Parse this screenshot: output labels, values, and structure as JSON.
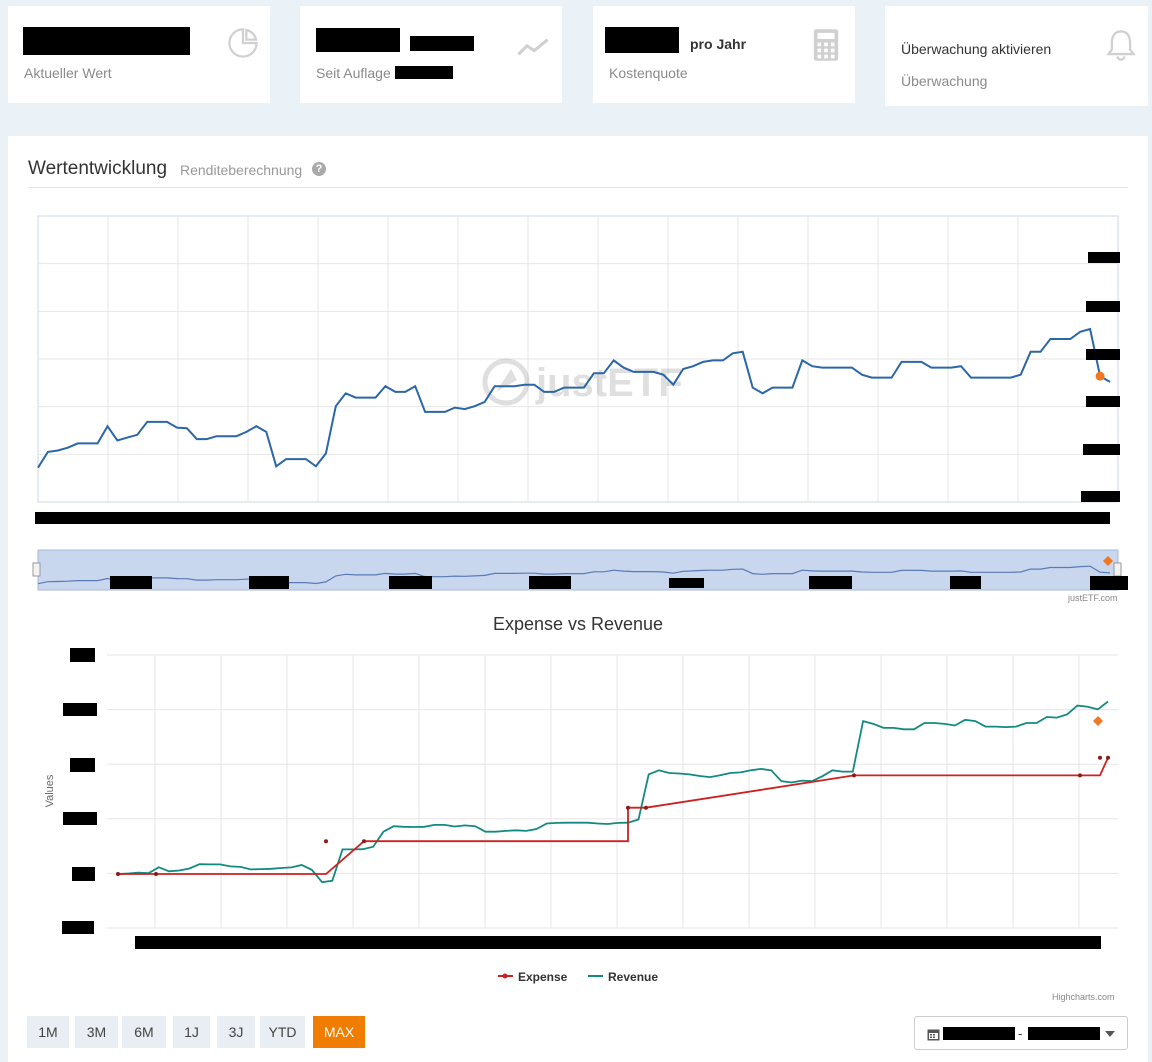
{
  "kpis": [
    {
      "sub": "Aktueller Wert",
      "icon": "pie-chart-icon"
    },
    {
      "sub": "Seit Auflage",
      "icon": "trend-line-icon"
    },
    {
      "suffix": "pro Jahr",
      "sub": "Kostenquote",
      "icon": "calculator-icon"
    },
    {
      "title": "Überwachung aktivieren",
      "sub": "Überwachung",
      "icon": "bell-icon"
    }
  ],
  "performance": {
    "title": "Wertentwicklung",
    "subtitle": "Renditeberechnung",
    "help": "?",
    "watermark": "justETF",
    "credit": "justETF.com"
  },
  "chart_data": [
    {
      "type": "line",
      "title": "",
      "ylim": [
        0,
        100
      ],
      "grid": true,
      "series": [
        {
          "values": [
            12,
            17.5,
            18,
            19,
            20.5,
            20.5,
            20.5,
            26.5,
            21.5,
            22.5,
            23.5,
            28,
            28,
            28,
            26,
            25.8,
            22,
            22,
            23,
            23,
            23,
            24.5,
            26.5,
            24.5,
            12.5,
            15,
            15,
            15,
            12.5,
            17,
            33.5,
            38,
            36.5,
            36.5,
            36.5,
            40.5,
            38.5,
            38.5,
            40.5,
            31.5,
            31.5,
            31.5,
            33,
            32.5,
            33.5,
            35,
            40.5,
            40.5,
            40.5,
            41,
            41,
            38.5,
            38.5,
            40,
            40,
            40,
            45,
            45,
            49.5,
            47,
            45.5,
            45.5,
            45.5,
            44.5,
            41,
            46.5,
            47.5,
            49,
            49.5,
            49.5,
            52,
            52.5,
            40,
            38,
            40,
            40,
            40,
            49.5,
            47.5,
            47,
            47,
            47,
            47,
            44.5,
            43.5,
            43.5,
            43.5,
            49,
            49,
            49,
            47,
            47,
            47,
            47.5,
            43.5,
            43.5,
            43.5,
            43.5,
            43.5,
            44.5,
            52.5,
            52.5,
            57,
            57,
            57,
            59.5,
            60.5,
            44,
            42
          ]
        }
      ]
    },
    {
      "type": "line",
      "title": "Expense vs Revenue",
      "ylabel": "Values",
      "ylim": [
        0,
        100
      ],
      "grid": true,
      "legend": "bottom-center",
      "series": [
        {
          "name": "Expense",
          "color": "#cc2222",
          "x": [
            0,
            10,
            55,
            55,
            65,
            65,
            68,
            68,
            155,
            155,
            155,
            415,
            415,
            415,
            517,
            517,
            517
          ],
          "values": [
            0,
            0,
            0,
            0,
            0,
            12,
            12,
            12,
            12,
            24.3,
            24.3,
            24.3,
            36.1,
            36.1,
            36.1,
            36.1,
            42.6
          ]
        },
        {
          "name": "Revenue",
          "color": "#138a7f",
          "values": [
            0,
            0.2,
            0.5,
            0.3,
            2.5,
            1,
            1.3,
            2,
            3.6,
            3.5,
            3.5,
            2.8,
            2.6,
            1.7,
            1.8,
            1.9,
            2.2,
            2.4,
            3.3,
            1.5,
            -3,
            -2.5,
            9,
            9,
            9.1,
            10,
            15.5,
            17.5,
            17.3,
            17.2,
            17.3,
            18,
            18,
            17.4,
            17.8,
            17.5,
            15.5,
            15.5,
            15.8,
            16,
            15.8,
            16.5,
            18.5,
            18.7,
            18.8,
            18.8,
            18.8,
            18.5,
            18.3,
            18.7,
            18.8,
            20,
            36.5,
            38,
            37,
            36.8,
            36.5,
            35.9,
            35.5,
            36.2,
            37,
            37.2,
            38,
            38.5,
            38,
            34,
            33.5,
            34.2,
            34,
            35.8,
            38,
            37.5,
            37.5,
            56,
            55,
            53.5,
            53.5,
            53,
            53,
            55.3,
            55.3,
            55,
            54.4,
            56.5,
            56,
            54,
            54,
            53.8,
            54,
            55.3,
            55.3,
            57.5,
            57.3,
            58.5,
            61.7,
            61.3,
            60.3,
            63.2
          ]
        }
      ]
    }
  ],
  "range_buttons": [
    "1M",
    "3M",
    "6M",
    "1J",
    "3J",
    "YTD",
    "MAX"
  ],
  "active_range": "MAX",
  "date_picker": {
    "separator": "-"
  },
  "highcharts_credit": "Highcharts.com",
  "colors": {
    "accent": "#ee7d00",
    "line": "#2b67a6",
    "marker": "#f07820",
    "expense": "#cc2222",
    "revenue": "#138a7f"
  }
}
